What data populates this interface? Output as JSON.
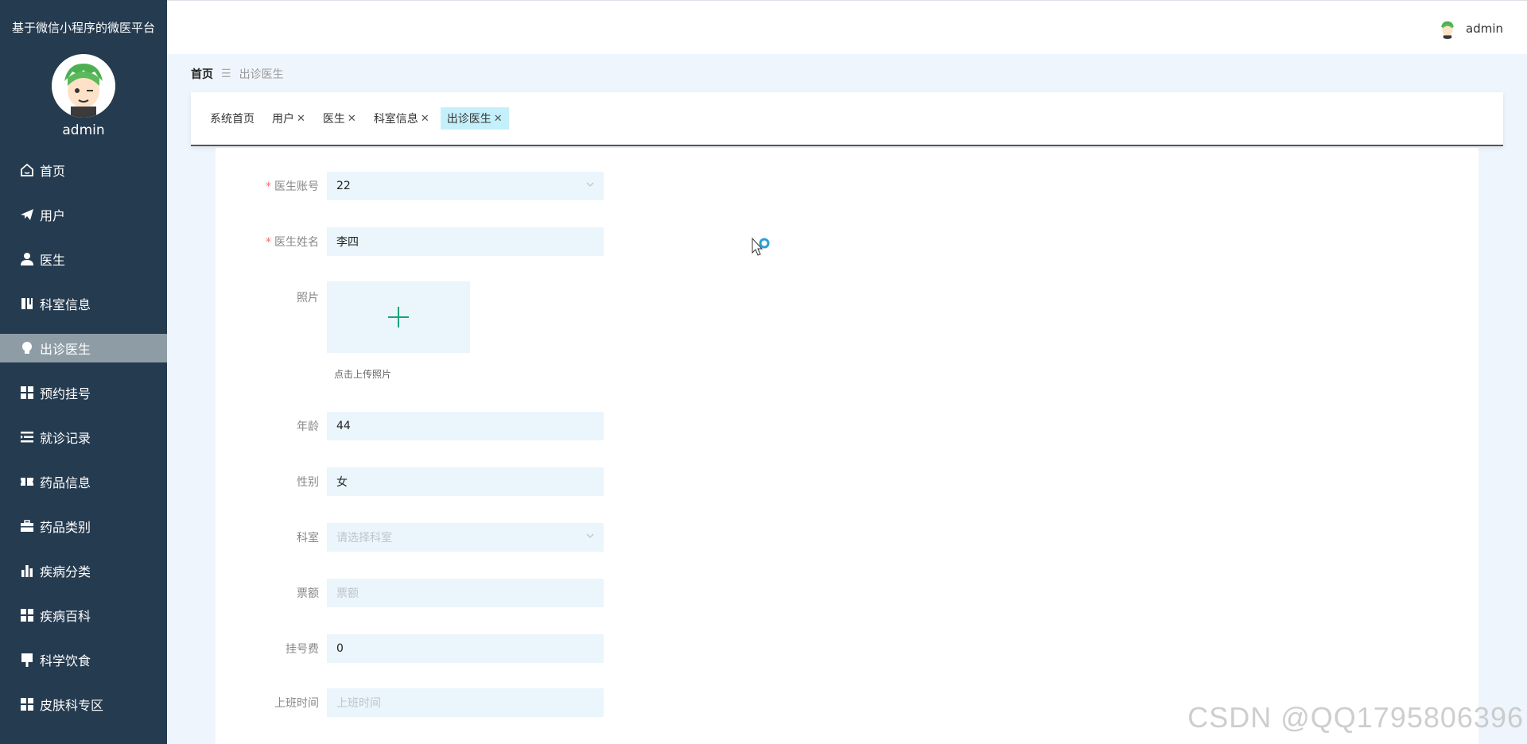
{
  "app": {
    "title": "基于微信小程序的微医平台"
  },
  "user": {
    "name": "admin"
  },
  "sidebar": {
    "items": [
      {
        "label": "首页",
        "icon": "home-icon"
      },
      {
        "label": "用户",
        "icon": "paper-plane-icon"
      },
      {
        "label": "医生",
        "icon": "user-icon"
      },
      {
        "label": "科室信息",
        "icon": "book-icon"
      },
      {
        "label": "出诊医生",
        "icon": "bulb-icon",
        "active": true
      },
      {
        "label": "预约挂号",
        "icon": "grid-icon"
      },
      {
        "label": "就诊记录",
        "icon": "list-indent-icon"
      },
      {
        "label": "药品信息",
        "icon": "ticket-icon"
      },
      {
        "label": "药品类别",
        "icon": "briefcase-icon"
      },
      {
        "label": "疾病分类",
        "icon": "bar-chart-icon"
      },
      {
        "label": "疾病百科",
        "icon": "grid-icon"
      },
      {
        "label": "科学饮食",
        "icon": "brush-icon"
      },
      {
        "label": "皮肤科专区",
        "icon": "grid-icon"
      }
    ]
  },
  "topbar": {
    "username": "admin"
  },
  "breadcrumb": {
    "home": "首页",
    "separator": "☰",
    "current": "出诊医生"
  },
  "tabs": [
    {
      "label": "系统首页",
      "closable": false
    },
    {
      "label": "用户",
      "closable": true
    },
    {
      "label": "医生",
      "closable": true
    },
    {
      "label": "科室信息",
      "closable": true
    },
    {
      "label": "出诊医生",
      "closable": true,
      "active": true
    }
  ],
  "form": {
    "doctor_account": {
      "label": "医生账号",
      "value": "22",
      "required": true
    },
    "doctor_name": {
      "label": "医生姓名",
      "value": "李四",
      "required": true
    },
    "photo": {
      "label": "照片",
      "tip": "点击上传照片"
    },
    "age": {
      "label": "年龄",
      "value": "44"
    },
    "gender": {
      "label": "性别",
      "value": "女"
    },
    "department": {
      "label": "科室",
      "placeholder": "请选择科室"
    },
    "ticket_amount": {
      "label": "票额",
      "placeholder": "票额"
    },
    "registration_fee": {
      "label": "挂号费",
      "value": "0"
    },
    "work_time": {
      "label": "上班时间",
      "placeholder": "上班时间"
    }
  },
  "watermark": "CSDN @QQ1795806396",
  "colors": {
    "sidebar_bg": "#253b50",
    "active_menu_bg": "#8e9ca6",
    "active_tab_bg": "#c4f0fb",
    "input_bg": "#eaf5fc",
    "upload_plus": "#1aa37a",
    "required": "#f56c6c"
  }
}
